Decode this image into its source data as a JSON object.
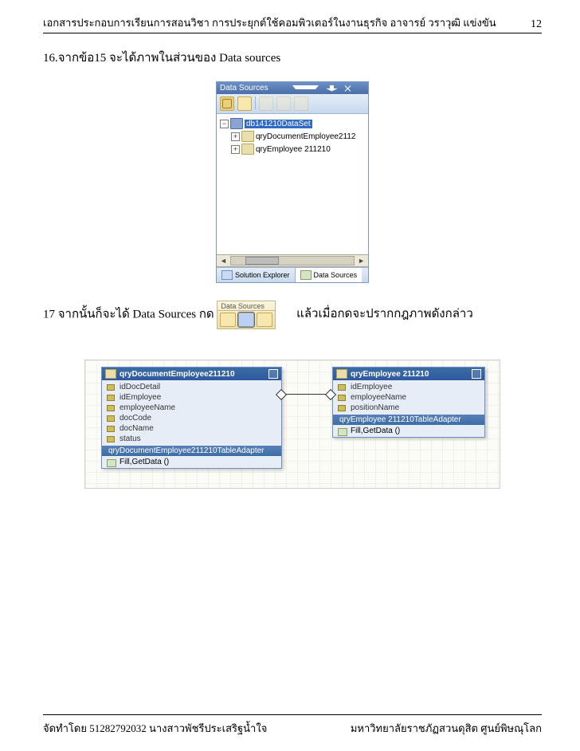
{
  "header": {
    "text": "เอกสารประกอบการเรียนการสอนวิชา การประยุกต์ใช้คอมพิวเตอร์ในงานธุรกิจ อาจารย์ วราวุฒิ แข่งขัน",
    "page": "12"
  },
  "line16": "16.จากข้อ15 จะได้ภาพในส่วนของ Data  sources",
  "ds_panel": {
    "title": "Data Sources",
    "tree": {
      "root": "db141210DataSet",
      "items": [
        "qryDocumentEmployee2112",
        "qryEmployee 211210"
      ]
    },
    "tab_a": "Solution Explorer",
    "tab_b": "Data Sources"
  },
  "line17": {
    "a": "17 จากนั้นก็จะได้ Data Sources กด",
    "b": "แล้วเมื่อกดจะปรากกฎภาพดังกล่าว",
    "mini_label": "Data Sources"
  },
  "designer": {
    "entity_a": {
      "title": "qryDocumentEmployee211210",
      "fields": [
        "idDocDetail",
        "idEmployee",
        "employeeName",
        "docCode",
        "docName",
        "status"
      ],
      "adapter": "qryDocumentEmployee211210TableAdapter",
      "method": "Fill,GetData ()"
    },
    "entity_b": {
      "title": "qryEmployee 211210",
      "fields": [
        "idEmployee",
        "employeeName",
        "positionName"
      ],
      "adapter": "qryEmployee 211210TableAdapter",
      "method": "Fill,GetData ()"
    }
  },
  "footer": {
    "left": "จัดทำโดย 51282792032 นางสาวพัชรีประเสริฐน้ำใจ",
    "right": "มหาวิทยาลัยราชภัฏสวนดุสิต ศูนย์พิษณุโลก"
  }
}
